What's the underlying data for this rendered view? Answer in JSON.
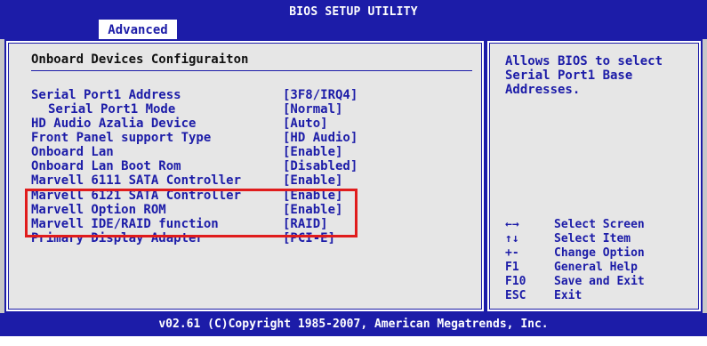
{
  "app": {
    "title": "BIOS SETUP UTILITY",
    "active_tab": "Advanced",
    "footer": "v02.61 (C)Copyright 1985-2007, American Megatrends, Inc."
  },
  "section": {
    "title": "Onboard Devices Configuraiton"
  },
  "settings": [
    {
      "label": "Serial Port1 Address",
      "value": "[3F8/IRQ4]"
    },
    {
      "label": "Serial Port1 Mode",
      "value": "[Normal]"
    },
    {
      "label": "HD Audio Azalia Device",
      "value": "[Auto]"
    },
    {
      "label": "Front Panel support Type",
      "value": "[HD Audio]"
    },
    {
      "label": "Onboard Lan",
      "value": "[Enable]"
    },
    {
      "label": "Onboard Lan Boot Rom",
      "value": "[Disabled]"
    },
    {
      "label": "Marvell 6111 SATA Controller",
      "value": "[Enable]"
    },
    {
      "label": "Marvell 6121 SATA Controller",
      "value": "[Enable]"
    },
    {
      "label": "Marvell Option ROM",
      "value": "[Enable]"
    },
    {
      "label": "Marvell IDE/RAID function",
      "value": "[RAID]"
    },
    {
      "label": "Primary Display Adapter",
      "value": "[PCI-E]"
    }
  ],
  "help": {
    "text": "Allows BIOS to select Serial Port1 Base Addresses."
  },
  "keys": [
    {
      "key": "←→",
      "desc": "Select Screen"
    },
    {
      "key": "↑↓",
      "desc": "Select Item"
    },
    {
      "key": "+-",
      "desc": "Change Option"
    },
    {
      "key": "F1",
      "desc": "General Help"
    },
    {
      "key": "F10",
      "desc": "Save and Exit"
    },
    {
      "key": "ESC",
      "desc": "Exit"
    }
  ],
  "colors": {
    "bios_blue": "#1c1ca8",
    "highlight_red": "#e01c1c",
    "panel_grey": "#e6e6e6"
  }
}
